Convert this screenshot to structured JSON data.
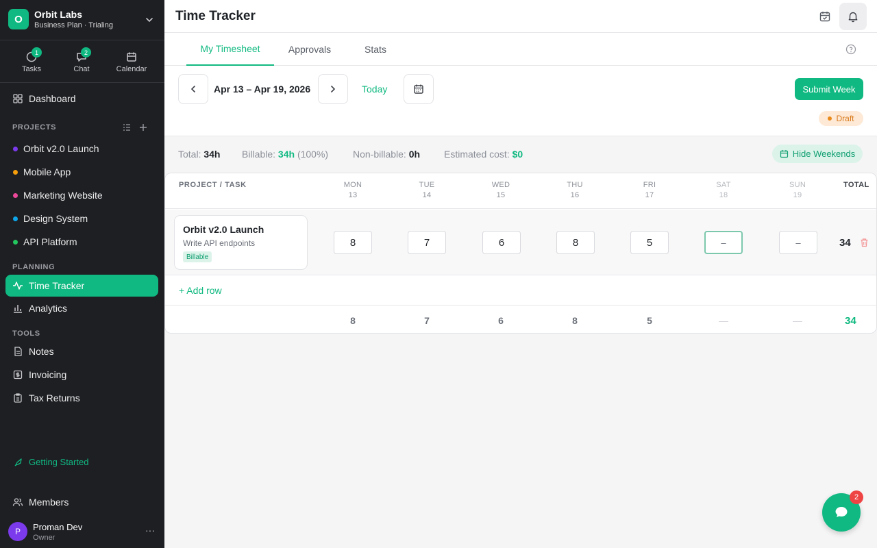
{
  "org": {
    "name": "Orbit Labs",
    "plan": "Business Plan · Trialing",
    "initial": "O"
  },
  "quick": {
    "tasks": {
      "label": "Tasks",
      "badge": "1"
    },
    "chat": {
      "label": "Chat",
      "badge": "2"
    },
    "calendar": {
      "label": "Calendar"
    }
  },
  "nav": {
    "dashboard": "Dashboard",
    "projects_label": "PROJECTS",
    "projects": [
      {
        "label": "Orbit v2.0 Launch",
        "color": "#7c3aed"
      },
      {
        "label": "Mobile App",
        "color": "#f59e0b"
      },
      {
        "label": "Marketing Website",
        "color": "#ec4899"
      },
      {
        "label": "Design System",
        "color": "#0ea5e9"
      },
      {
        "label": "API Platform",
        "color": "#22c55e"
      }
    ],
    "planning_label": "PLANNING",
    "time_tracker": "Time Tracker",
    "analytics": "Analytics",
    "tools_label": "TOOLS",
    "notes": "Notes",
    "invoicing": "Invoicing",
    "tax_returns": "Tax Returns",
    "getting_started": "Getting Started",
    "members": "Members"
  },
  "user": {
    "name": "Proman Dev",
    "role": "Owner",
    "initial": "P"
  },
  "header": {
    "title": "Time Tracker"
  },
  "tabs": [
    "My Timesheet",
    "Approvals",
    "Stats"
  ],
  "toolbar": {
    "range": "Apr 13 – Apr 19, 2026",
    "today": "Today",
    "submit": "Submit Week",
    "status": "Draft"
  },
  "summary": {
    "total_label": "Total:",
    "total": "34h",
    "billable_label": "Billable:",
    "billable": "34h",
    "billable_pct": "(100%)",
    "nonbillable_label": "Non-billable:",
    "nonbillable": "0h",
    "cost_label": "Estimated cost:",
    "cost": "$0",
    "hide_weekends": "Hide Weekends"
  },
  "grid": {
    "project_header": "PROJECT / TASK",
    "total_header": "TOTAL",
    "days": [
      {
        "name": "MON",
        "date": "13"
      },
      {
        "name": "TUE",
        "date": "14"
      },
      {
        "name": "WED",
        "date": "15"
      },
      {
        "name": "THU",
        "date": "16"
      },
      {
        "name": "FRI",
        "date": "17"
      },
      {
        "name": "SAT",
        "date": "18"
      },
      {
        "name": "SUN",
        "date": "19"
      }
    ],
    "row": {
      "project": "Orbit v2.0 Launch",
      "task": "Write API endpoints",
      "badge": "Billable",
      "hours": [
        "8",
        "7",
        "6",
        "8",
        "5",
        "–",
        "–"
      ],
      "total": "34"
    },
    "add_row": "+ Add row",
    "footer": [
      "8",
      "7",
      "6",
      "8",
      "5",
      "—",
      "—"
    ],
    "footer_total": "34"
  },
  "chat_fab": {
    "badge": "2"
  },
  "colors": {
    "accent": "#10b981",
    "sidebar": "#1e1f23",
    "draft": "#d9791a",
    "danger": "#ef4444"
  }
}
